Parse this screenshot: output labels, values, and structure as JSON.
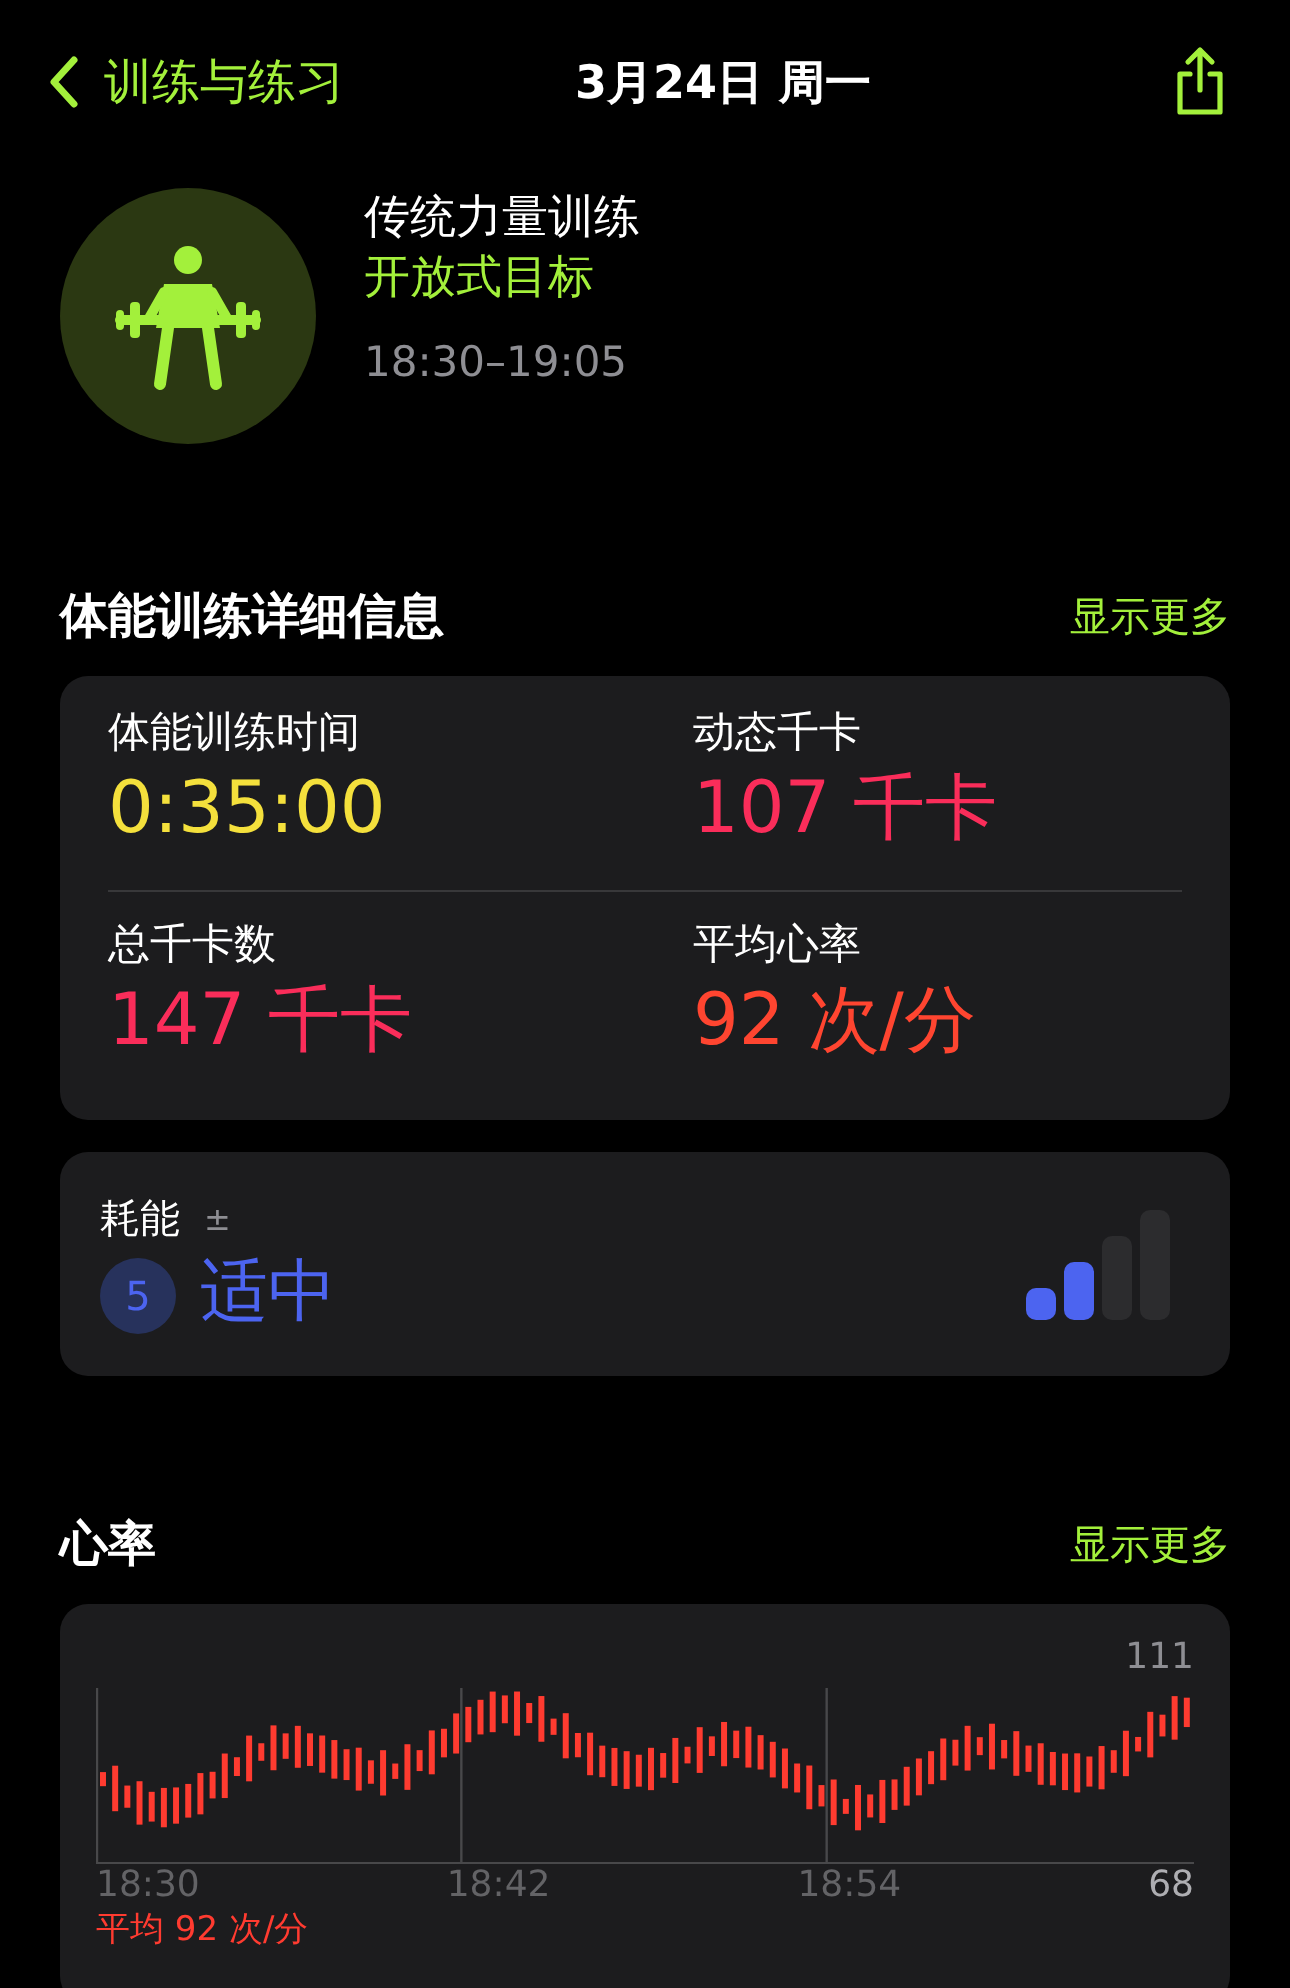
{
  "nav": {
    "back": "训练与练习",
    "title": "3月24日 周一"
  },
  "workout": {
    "name": "传统力量训练",
    "goal": "开放式目标",
    "time": "18:30–19:05"
  },
  "details": {
    "title": "体能训练详细信息",
    "more": "显示更多",
    "stats": [
      {
        "label": "体能训练时间",
        "value": "0:35:00",
        "color": "#f4e03c"
      },
      {
        "label": "动态千卡",
        "value": "107 千卡",
        "color": "#fa2d5a"
      },
      {
        "label": "总千卡数",
        "value": "147 千卡",
        "color": "#fa2d5a"
      },
      {
        "label": "平均心率",
        "value": "92 次/分",
        "color": "#ff4530"
      }
    ]
  },
  "effort": {
    "label": "耗能",
    "sign": "±",
    "score": "5",
    "rating": "适中",
    "level": 0.5
  },
  "heart": {
    "title": "心率",
    "more": "显示更多",
    "max": "111",
    "min": "68",
    "times": [
      "18:30",
      "18:42",
      "18:54"
    ],
    "average": "平均 92 次/分"
  }
}
